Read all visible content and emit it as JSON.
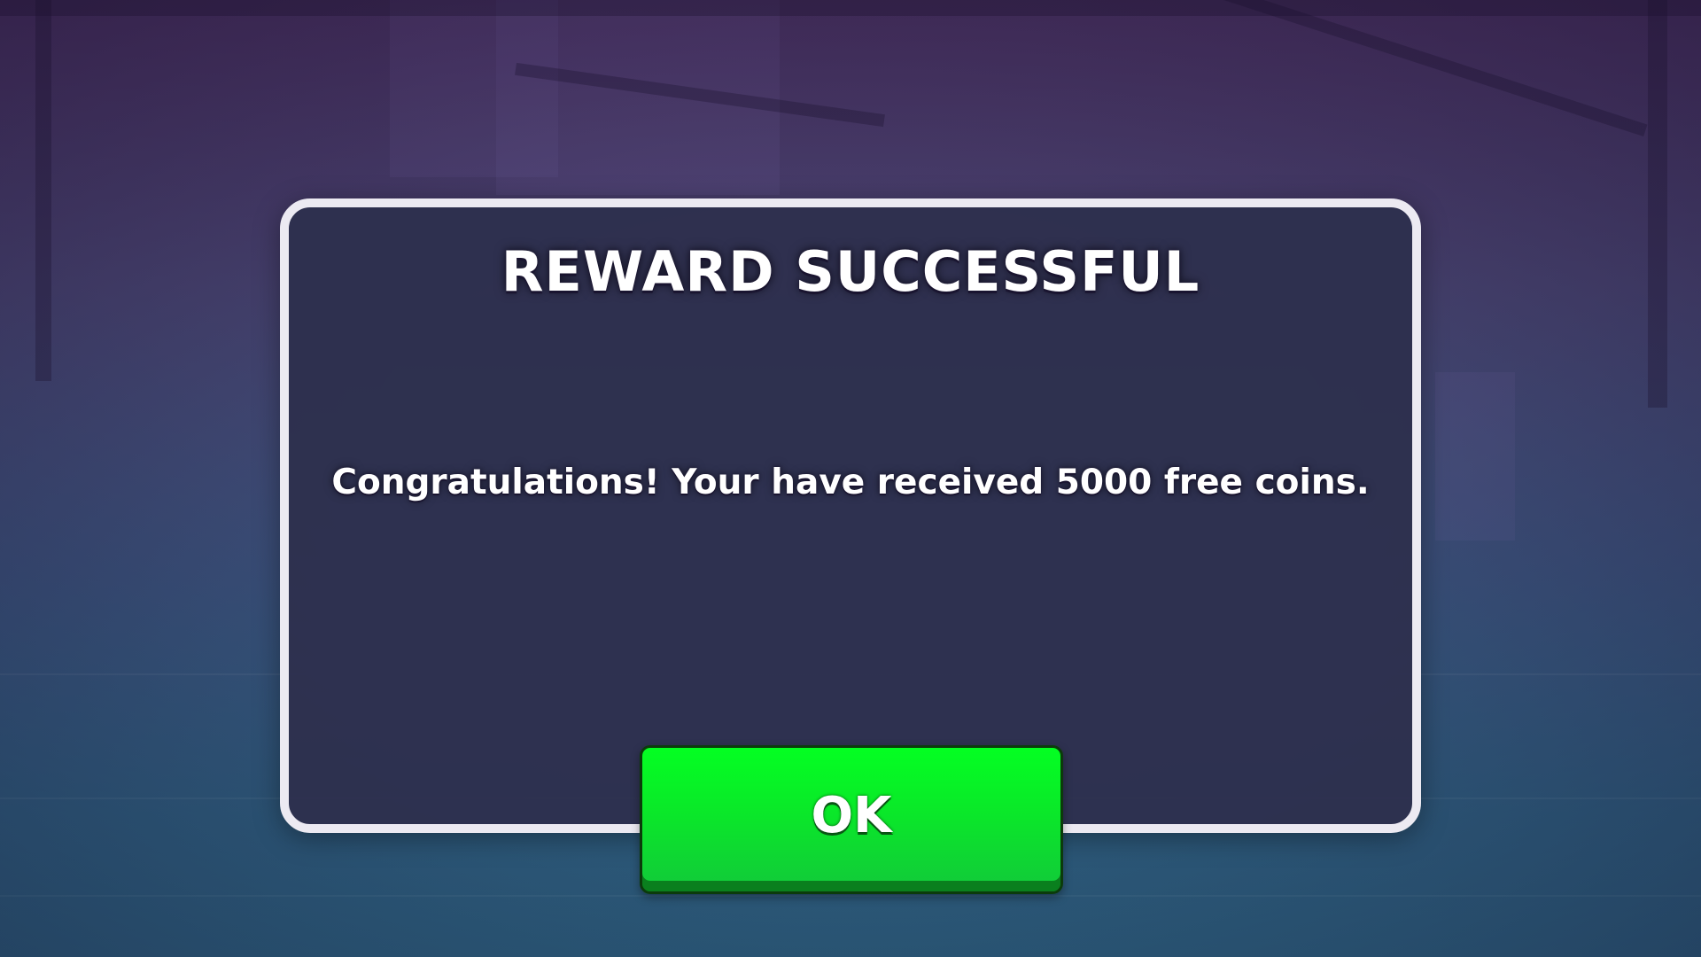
{
  "dialog": {
    "title": "REWARD SUCCESSFUL",
    "message": "Congratulations! Your have received 5000 free coins.",
    "ok_label": "OK"
  },
  "colors": {
    "dialog_border": "#eceaf2",
    "dialog_background": "#2e304e",
    "button_green": "#0ae829",
    "button_shadow": "#0a7f1e"
  }
}
